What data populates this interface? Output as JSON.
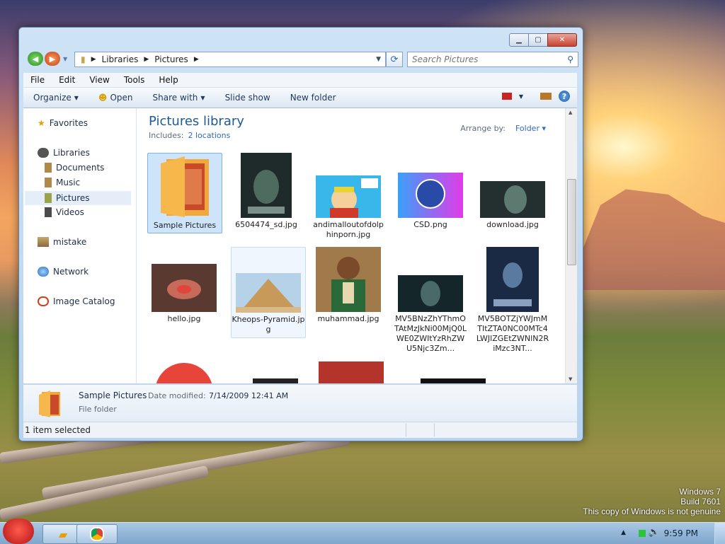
{
  "desktop": {
    "watermark": [
      "Windows 7",
      "Build 7601",
      "This copy of Windows is not genuine"
    ]
  },
  "window": {
    "address_parts": [
      "Libraries",
      "Pictures"
    ],
    "search_placeholder": "Search Pictures",
    "menus": [
      "File",
      "Edit",
      "View",
      "Tools",
      "Help"
    ],
    "toolbar": {
      "organize": "Organize",
      "open": "Open",
      "share_with": "Share with",
      "slide_show": "Slide show",
      "new_folder": "New folder"
    },
    "nav": {
      "favorites": "Favorites",
      "libraries": "Libraries",
      "documents": "Documents",
      "music": "Music",
      "pictures": "Pictures",
      "videos": "Videos",
      "mistake": "mistake",
      "network": "Network",
      "image_catalog": "Image Catalog"
    },
    "library": {
      "title": "Pictures library",
      "includes_label": "Includes:",
      "includes_link": "2 locations",
      "arrange_label": "Arrange by:",
      "arrange_value": "Folder"
    },
    "items": [
      {
        "name": "Sample Pictures"
      },
      {
        "name": "6504474_sd.jpg"
      },
      {
        "name": "andimalloutofdolphinporn.jpg"
      },
      {
        "name": "CSD.png"
      },
      {
        "name": "download.jpg"
      },
      {
        "name": "hello.jpg"
      },
      {
        "name": "Kheops-Pyramid.jpg"
      },
      {
        "name": "muhammad.jpg"
      },
      {
        "name": "MV5BNzZhYThmOTAtMzJkNi00MjQ0LWE0ZWItYzRhZWU5Njc3Zm..."
      },
      {
        "name": "MV5BOTZjYWJmMTItZTA0NC00MTc4LWJlZGEtZWNlN2RiMzc3NT..."
      }
    ],
    "details": {
      "name": "Sample Pictures",
      "date_label": "Date modified:",
      "date_value": "7/14/2009 12:41 AM",
      "type": "File folder"
    },
    "status": "1 item selected"
  },
  "taskbar": {
    "clock": "9:59 PM"
  },
  "colors": {
    "accent_title": "#1e5a96",
    "selection": "#cde4fb"
  }
}
